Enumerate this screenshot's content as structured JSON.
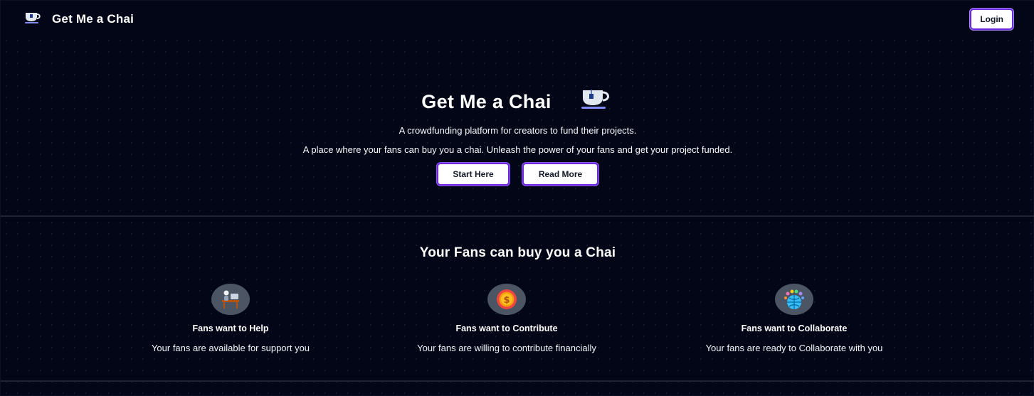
{
  "navbar": {
    "brand_name": "Get Me a Chai",
    "brand_icon": "tea-cup-icon",
    "login_label": "Login"
  },
  "hero": {
    "title": "Get Me a Chai",
    "title_icon": "tea-cup-icon",
    "subtitle_1": "A crowdfunding platform for creators to fund their projects.",
    "subtitle_2": "A place where your fans can buy you a chai. Unleash the power of your fans and get your project funded.",
    "start_label": "Start Here",
    "read_more_label": "Read More"
  },
  "features": {
    "heading": "Your Fans can buy you a Chai",
    "items": [
      {
        "icon": "person-at-desk-icon",
        "title": "Fans want to Help",
        "description": "Your fans are available for support you"
      },
      {
        "icon": "gold-coin-icon",
        "title": "Fans want to Contribute",
        "description": "Your fans are willing to contribute financially"
      },
      {
        "icon": "globe-people-icon",
        "title": "Fans want to Collaborate",
        "description": "Your fans are ready to Collaborate with you"
      }
    ]
  },
  "colors": {
    "background": "#020617",
    "button_border": "#6d28d9",
    "icon_circle": "#4b5563"
  }
}
